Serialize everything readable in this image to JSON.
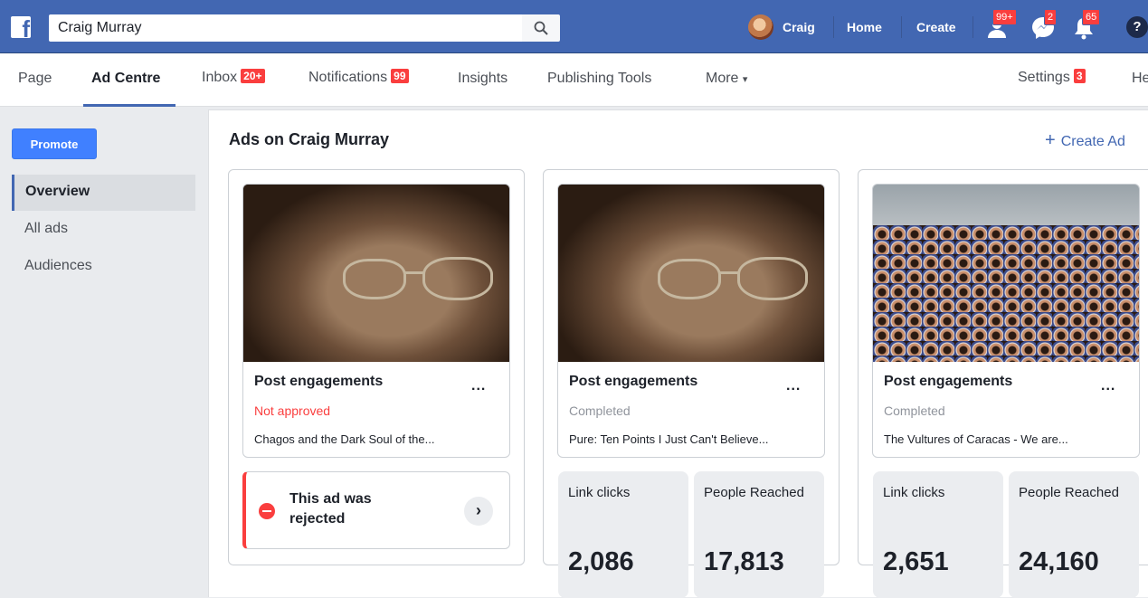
{
  "topbar": {
    "search_value": "Craig Murray",
    "profile_name": "Craig",
    "home_label": "Home",
    "create_label": "Create",
    "friend_requests_badge": "99+",
    "messages_badge": "2",
    "notifications_badge": "65",
    "help_label": "?"
  },
  "page_nav": {
    "tabs": [
      {
        "label": "Page"
      },
      {
        "label": "Ad Centre"
      },
      {
        "label": "Inbox",
        "badge": "20+"
      },
      {
        "label": "Notifications",
        "badge": "99"
      },
      {
        "label": "Insights"
      },
      {
        "label": "Publishing Tools"
      },
      {
        "label": "More"
      },
      {
        "label": "Settings",
        "badge": "3"
      },
      {
        "label": "He"
      }
    ],
    "more_caret": "▾"
  },
  "sidebar": {
    "promote_label": "Promote",
    "items": [
      {
        "label": "Overview"
      },
      {
        "label": "All ads"
      },
      {
        "label": "Audiences"
      }
    ]
  },
  "main": {
    "title": "Ads on Craig Murray",
    "create_ad_label": "Create Ad",
    "create_ad_icon": "+"
  },
  "ads": [
    {
      "objective": "Post engagements",
      "status": "Not approved",
      "description": "Chagos and the Dark Soul of the...",
      "rejection": {
        "text": "This ad was rejected",
        "chevron": "›"
      }
    },
    {
      "objective": "Post engagements",
      "status": "Completed",
      "description": "Pure: Ten Points I Just Can't Believe...",
      "stats": [
        {
          "label": "Link clicks",
          "value": "2,086"
        },
        {
          "label": "People Reached",
          "value": "17,813"
        }
      ]
    },
    {
      "objective": "Post engagements",
      "status": "Completed",
      "description": "The Vultures of Caracas - We are...",
      "stats": [
        {
          "label": "Link clicks",
          "value": "2,651"
        },
        {
          "label": "People Reached",
          "value": "24,160"
        }
      ]
    }
  ],
  "more_dots": "...",
  "colors": {
    "brand": "#4267b2",
    "accent": "#4080ff",
    "alert": "#fa3e3e"
  }
}
